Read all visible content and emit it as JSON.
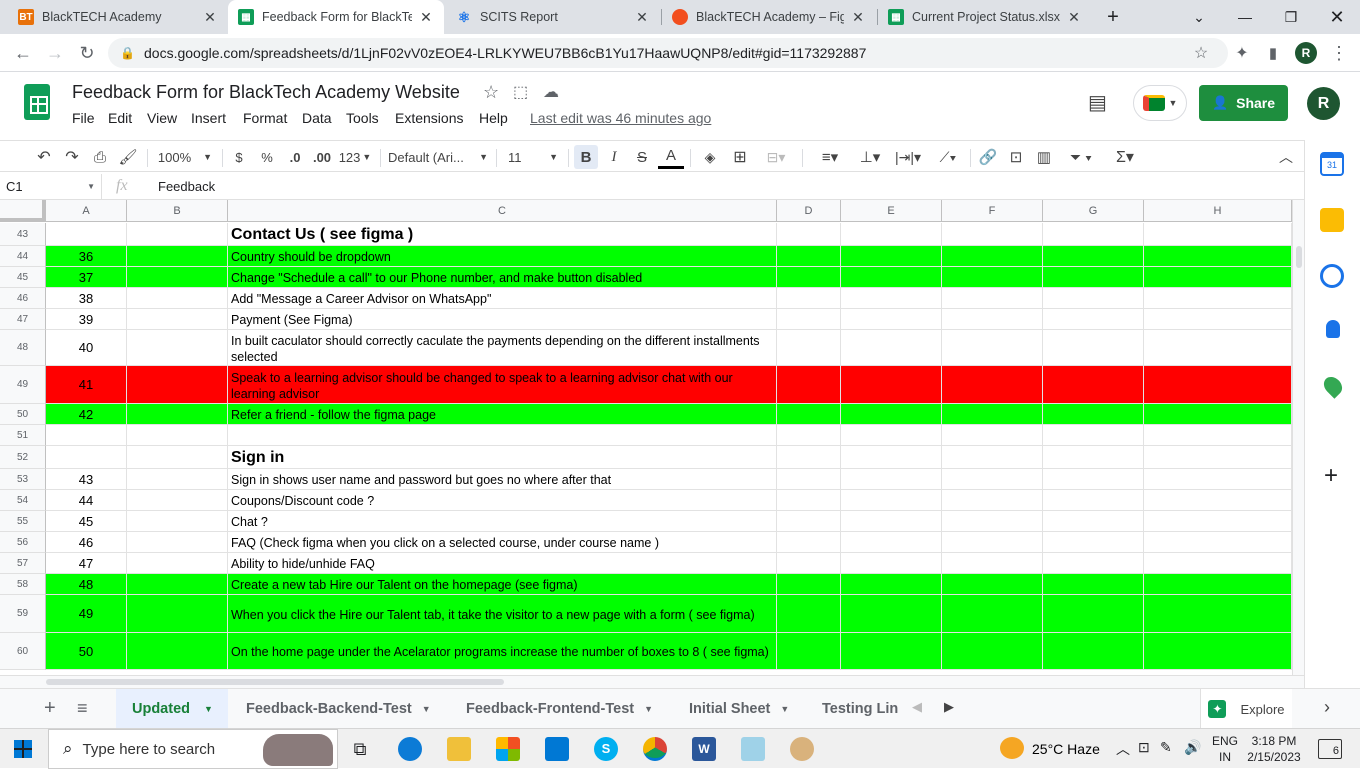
{
  "browser": {
    "tabs": [
      {
        "title": "BlackTECH Academy",
        "fav": "BT",
        "color": "#e8710a"
      },
      {
        "title": "Feedback Form for BlackTech",
        "fav": "",
        "color": "#0f9d58"
      },
      {
        "title": "SCITS Report",
        "fav": "",
        "color": "#1a73e8"
      },
      {
        "title": "BlackTECH Academy – Figma",
        "fav": "",
        "color": "#f24e1e"
      },
      {
        "title": "Current Project Status.xlsx - G",
        "fav": "",
        "color": "#0f9d58"
      }
    ],
    "url": "docs.google.com/spreadsheets/d/1LjnF02vV0zEOE4-LRLKYWEU7BB6cB1Yu17HaawUQNP8/edit#gid=1173292887",
    "profile_initial": "R"
  },
  "doc": {
    "title": "Feedback Form for BlackTech Academy Website",
    "menu": [
      "File",
      "Edit",
      "View",
      "Insert",
      "Format",
      "Data",
      "Tools",
      "Extensions",
      "Help"
    ],
    "last_edit": "Last edit was 46 minutes ago",
    "share_label": "Share",
    "avatar_initial": "R"
  },
  "toolbar": {
    "zoom": "100%",
    "currency": "$",
    "percent": "%",
    "dec_decrease": ".0",
    "dec_increase": ".00",
    "more_formats": "123",
    "font": "Default (Ari...",
    "font_size": "11"
  },
  "formula_bar": {
    "name_box": "C1",
    "fx": "fx",
    "value": "Feedback"
  },
  "columns": [
    "A",
    "B",
    "C",
    "D",
    "E",
    "F",
    "G",
    "H"
  ],
  "rows": [
    {
      "n": "43",
      "a": "",
      "c": "Contact Us ( see figma )",
      "style": "header"
    },
    {
      "n": "44",
      "a": "36",
      "c": "Country should be dropdown",
      "style": "green"
    },
    {
      "n": "45",
      "a": "37",
      "c": "Change \"Schedule a call\" to our Phone number, and make button disabled",
      "style": "green"
    },
    {
      "n": "46",
      "a": "38",
      "c": "Add \"Message a Career Advisor on WhatsApp\"",
      "style": ""
    },
    {
      "n": "47",
      "a": "39",
      "c": "Payment (See Figma)",
      "style": ""
    },
    {
      "n": "48",
      "a": "40",
      "c": "In built caculator should correctly caculate the payments depending on the different installments selected",
      "style": "tall"
    },
    {
      "n": "49",
      "a": "41",
      "c": "Speak to a learning advisor should be changed to speak to a learning advisor chat  with our learning advisor",
      "style": "red"
    },
    {
      "n": "50",
      "a": "42",
      "c": "Refer a friend - follow the figma page",
      "style": "green"
    },
    {
      "n": "51",
      "a": "",
      "c": "",
      "style": ""
    },
    {
      "n": "52",
      "a": "",
      "c": "Sign in",
      "style": "header"
    },
    {
      "n": "53",
      "a": "43",
      "c": "Sign in shows user name and password but goes no where after that",
      "style": ""
    },
    {
      "n": "54",
      "a": "44",
      "c": "Coupons/Discount code ?",
      "style": ""
    },
    {
      "n": "55",
      "a": "45",
      "c": "Chat ?",
      "style": ""
    },
    {
      "n": "56",
      "a": "46",
      "c": "FAQ (Check figma when you click on a selected course, under course name )",
      "style": ""
    },
    {
      "n": "57",
      "a": "47",
      "c": "Ability to hide/unhide FAQ",
      "style": ""
    },
    {
      "n": "58",
      "a": "48",
      "c": "Create a new tab Hire our Talent on the homepage (see figma)",
      "style": "green"
    },
    {
      "n": "59",
      "a": "49",
      "c": "When you click the Hire our Talent tab, it take the visitor to a new page with a form ( see figma)",
      "style": "green"
    },
    {
      "n": "60",
      "a": "50",
      "c": "On the home page under the Acelarator programs increase the number of boxes to 8 ( see figma)",
      "style": "green"
    }
  ],
  "sheet_tabs": [
    "Updated",
    "Feedback-Backend-Test",
    "Feedback-Frontend-Test",
    "Initial Sheet",
    "Testing Lin"
  ],
  "explore_label": "Explore",
  "taskbar": {
    "search_placeholder": "Type here to search",
    "weather": "25°C  Haze",
    "lang1": "ENG",
    "lang2": "IN",
    "time": "3:18 PM",
    "date": "2/15/2023",
    "notif_count": "6"
  },
  "colors": {
    "green_fill": "#00ff00",
    "red_fill": "#ff0000",
    "share_green": "#1e8e3e"
  }
}
